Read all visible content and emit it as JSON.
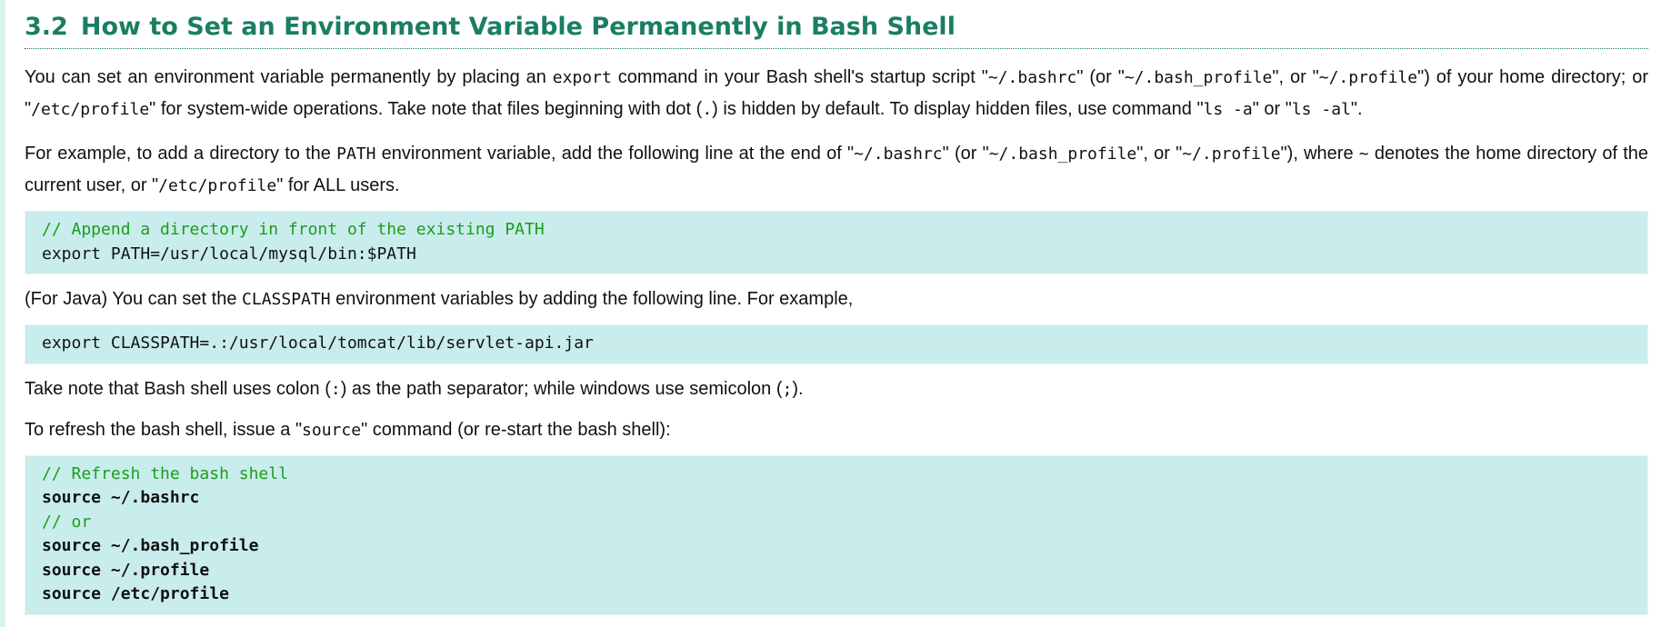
{
  "heading": {
    "number": "3.2",
    "title": "How to Set an Environment Variable Permanently in Bash Shell"
  },
  "para1": {
    "t1": "You can set an environment variable permanently by placing an ",
    "c1": "export",
    "t2": " command in your Bash shell's startup script \"",
    "c2": "~/.bashrc",
    "t3": "\" (or \"",
    "c3": "~/.bash_profile",
    "t4": "\", or \"",
    "c4": "~/.profile",
    "t5": "\") of your home directory; or \"",
    "c5": "/etc/profile",
    "t6": "\" for system-wide operations. Take note that files beginning with dot (",
    "c6": ".",
    "t7": ") is hidden by default. To display hidden files, use command \"",
    "c7": "ls -a",
    "t8": "\" or \"",
    "c8": "ls -al",
    "t9": "\"."
  },
  "para2": {
    "t1": "For example, to add a directory to the ",
    "c1": "PATH",
    "t2": " environment variable, add the following line at the end of \"",
    "c2": "~/.bashrc",
    "t3": "\" (or \"",
    "c3": "~/.bash_profile",
    "t4": "\", or \"",
    "c4": "~/.profile",
    "t5": "\"), where ",
    "c5": "~",
    "t6": " denotes the home directory of the current user, or \"",
    "c6": "/etc/profile",
    "t7": "\" for ALL users."
  },
  "code1": {
    "comment": "// Append a directory in front of the existing PATH",
    "line": "export PATH=/usr/local/mysql/bin:$PATH"
  },
  "para3": {
    "t1": "(For Java) You can set the ",
    "c1": "CLASSPATH",
    "t2": " environment variables by adding the following line. For example,"
  },
  "code2": {
    "line": "export CLASSPATH=.:/usr/local/tomcat/lib/servlet-api.jar"
  },
  "para4": {
    "t1": "Take note that Bash shell uses colon (",
    "c1": ":",
    "t2": ") as the path separator; while windows use semicolon (",
    "c2": ";",
    "t3": ")."
  },
  "para5": {
    "t1": "To refresh the bash shell, issue a \"",
    "c1": "source",
    "t2": "\" command (or re-start the bash shell):"
  },
  "code3": {
    "comment1": "// Refresh the bash shell",
    "line1": "source ~/.bashrc",
    "comment2": "// or",
    "line2": "source ~/.bash_profile",
    "line3": "source ~/.profile",
    "line4": "source /etc/profile"
  },
  "colors": {
    "heading": "#1a7e63",
    "code_background": "#c9ecec",
    "code_comment": "#1b9e1b",
    "left_strip": "#d9f4ea"
  }
}
